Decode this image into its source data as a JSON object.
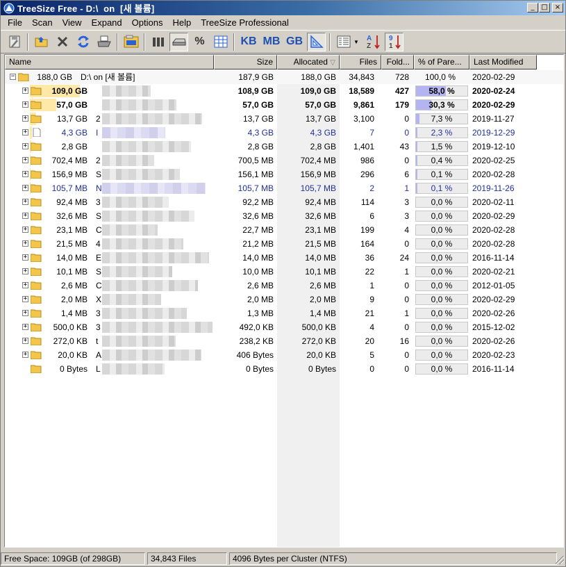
{
  "window": {
    "title": "TreeSize Free - D:\\  on  [새 볼륨]",
    "controls": [
      "_",
      "□",
      "×"
    ]
  },
  "menu": [
    "File",
    "Scan",
    "View",
    "Expand",
    "Options",
    "Help",
    "TreeSize Professional"
  ],
  "toolbar": {
    "tools": [
      "save-icon",
      "open-folder-icon",
      "stop-icon",
      "refresh-icon",
      "print-icon",
      "explorer-icon",
      "bar-chart-icon",
      "drive-icon",
      "percent-icon",
      "grid-icon",
      "kb-unit",
      "mb-unit",
      "gb-unit",
      "triangle-icon",
      "details-icon",
      "sort-alpha-icon",
      "sort-numeric-icon"
    ],
    "percent_label": "%",
    "kb_label": "KB",
    "mb_label": "MB",
    "gb_label": "GB"
  },
  "columns": {
    "name": "Name",
    "size": "Size",
    "allocated": "Allocated",
    "allocated_sort": "▽",
    "files": "Files",
    "folders": "Fold...",
    "percent": "% of Pare...",
    "modified": "Last Modified"
  },
  "colors": {
    "title_bar": "#0a246a",
    "size_bar": "#ffe9a8",
    "percent_fill": "#b4b4f0",
    "link_blue": "#1f2ea0"
  },
  "root": {
    "size_label": "188,0 GB",
    "name": "D:\\  on  [새 볼륨]",
    "size": "187,9 GB",
    "allocated": "188,0 GB",
    "files": "34,843",
    "folders": "728",
    "percent": "100,0 %",
    "modified": "2020-02-29"
  },
  "rows": [
    {
      "size_label": "109,0 GB",
      "name": "",
      "size": "108,9 GB",
      "allocated": "109,0 GB",
      "files": "18,589",
      "folders": "427",
      "percent": "58,0 %",
      "pct": 58.0,
      "modified": "2020-02-24",
      "bold": true,
      "blue": false,
      "file": false
    },
    {
      "size_label": "57,0 GB",
      "name": "",
      "size": "57,0 GB",
      "allocated": "57,0 GB",
      "files": "9,861",
      "folders": "179",
      "percent": "30,3 %",
      "pct": 30.3,
      "modified": "2020-02-29",
      "bold": true,
      "blue": false,
      "file": false
    },
    {
      "size_label": "13,7 GB",
      "name": "2",
      "size": "13,7 GB",
      "allocated": "13,7 GB",
      "files": "3,100",
      "folders": "0",
      "percent": "7,3 %",
      "pct": 7.3,
      "modified": "2019-11-27",
      "bold": false,
      "blue": false,
      "file": false
    },
    {
      "size_label": "4,3 GB",
      "name": "I",
      "size": "4,3 GB",
      "allocated": "4,3 GB",
      "files": "7",
      "folders": "0",
      "percent": "2,3 %",
      "pct": 2.3,
      "modified": "2019-12-29",
      "bold": false,
      "blue": true,
      "file": true
    },
    {
      "size_label": "2,8 GB",
      "name": "",
      "size": "2,8 GB",
      "allocated": "2,8 GB",
      "files": "1,401",
      "folders": "43",
      "percent": "1,5 %",
      "pct": 1.5,
      "modified": "2019-12-10",
      "bold": false,
      "blue": false,
      "file": false
    },
    {
      "size_label": "702,4 MB",
      "name": "2",
      "size": "700,5 MB",
      "allocated": "702,4 MB",
      "files": "986",
      "folders": "0",
      "percent": "0,4 %",
      "pct": 0.4,
      "modified": "2020-02-25",
      "bold": false,
      "blue": false,
      "file": false
    },
    {
      "size_label": "156,9 MB",
      "name": "S",
      "size": "156,1 MB",
      "allocated": "156,9 MB",
      "files": "296",
      "folders": "6",
      "percent": "0,1 %",
      "pct": 0.1,
      "modified": "2020-02-28",
      "bold": false,
      "blue": false,
      "file": false
    },
    {
      "size_label": "105,7 MB",
      "name": "N",
      "size": "105,7 MB",
      "allocated": "105,7 MB",
      "files": "2",
      "folders": "1",
      "percent": "0,1 %",
      "pct": 0.1,
      "modified": "2019-11-26",
      "bold": false,
      "blue": true,
      "file": false
    },
    {
      "size_label": "92,4 MB",
      "name": "3",
      "size": "92,2 MB",
      "allocated": "92,4 MB",
      "files": "114",
      "folders": "3",
      "percent": "0,0 %",
      "pct": 0,
      "modified": "2020-02-11",
      "bold": false,
      "blue": false,
      "file": false
    },
    {
      "size_label": "32,6 MB",
      "name": "S",
      "size": "32,6 MB",
      "allocated": "32,6 MB",
      "files": "6",
      "folders": "3",
      "percent": "0,0 %",
      "pct": 0,
      "modified": "2020-02-29",
      "bold": false,
      "blue": false,
      "file": false
    },
    {
      "size_label": "23,1 MB",
      "name": "C",
      "size": "22,7 MB",
      "allocated": "23,1 MB",
      "files": "199",
      "folders": "4",
      "percent": "0,0 %",
      "pct": 0,
      "modified": "2020-02-28",
      "bold": false,
      "blue": false,
      "file": false
    },
    {
      "size_label": "21,5 MB",
      "name": "4",
      "size": "21,2 MB",
      "allocated": "21,5 MB",
      "files": "164",
      "folders": "0",
      "percent": "0,0 %",
      "pct": 0,
      "modified": "2020-02-28",
      "bold": false,
      "blue": false,
      "file": false
    },
    {
      "size_label": "14,0 MB",
      "name": "E",
      "size": "14,0 MB",
      "allocated": "14,0 MB",
      "files": "36",
      "folders": "24",
      "percent": "0,0 %",
      "pct": 0,
      "modified": "2016-11-14",
      "bold": false,
      "blue": false,
      "file": false
    },
    {
      "size_label": "10,1 MB",
      "name": "S",
      "size": "10,0 MB",
      "allocated": "10,1 MB",
      "files": "22",
      "folders": "1",
      "percent": "0,0 %",
      "pct": 0,
      "modified": "2020-02-21",
      "bold": false,
      "blue": false,
      "file": false
    },
    {
      "size_label": "2,6 MB",
      "name": "C",
      "size": "2,6 MB",
      "allocated": "2,6 MB",
      "files": "1",
      "folders": "0",
      "percent": "0,0 %",
      "pct": 0,
      "modified": "2012-01-05",
      "bold": false,
      "blue": false,
      "file": false
    },
    {
      "size_label": "2,0 MB",
      "name": "X",
      "size": "2,0 MB",
      "allocated": "2,0 MB",
      "files": "9",
      "folders": "0",
      "percent": "0,0 %",
      "pct": 0,
      "modified": "2020-02-29",
      "bold": false,
      "blue": false,
      "file": false
    },
    {
      "size_label": "1,4 MB",
      "name": "3",
      "size": "1,3 MB",
      "allocated": "1,4 MB",
      "files": "21",
      "folders": "1",
      "percent": "0,0 %",
      "pct": 0,
      "modified": "2020-02-26",
      "bold": false,
      "blue": false,
      "file": false
    },
    {
      "size_label": "500,0 KB",
      "name": "3",
      "size": "492,0 KB",
      "allocated": "500,0 KB",
      "files": "4",
      "folders": "0",
      "percent": "0,0 %",
      "pct": 0,
      "modified": "2015-12-02",
      "bold": false,
      "blue": false,
      "file": false
    },
    {
      "size_label": "272,0 KB",
      "name": "t",
      "size": "238,2 KB",
      "allocated": "272,0 KB",
      "files": "20",
      "folders": "16",
      "percent": "0,0 %",
      "pct": 0,
      "modified": "2020-02-26",
      "bold": false,
      "blue": false,
      "file": false
    },
    {
      "size_label": "20,0 KB",
      "name": "A",
      "size": "406 Bytes",
      "allocated": "20,0 KB",
      "files": "5",
      "folders": "0",
      "percent": "0,0 %",
      "pct": 0,
      "modified": "2020-02-23",
      "bold": false,
      "blue": false,
      "file": false
    },
    {
      "size_label": "0 Bytes",
      "name": "L",
      "size": "0 Bytes",
      "allocated": "0 Bytes",
      "files": "0",
      "folders": "0",
      "percent": "0,0 %",
      "pct": 0,
      "modified": "2016-11-14",
      "bold": false,
      "blue": false,
      "file": false,
      "no_expander": true
    }
  ],
  "status": {
    "free_space": "Free Space: 109GB  (of 298GB)",
    "files": "34,843  Files",
    "cluster": "4096  Bytes per Cluster (NTFS)"
  }
}
